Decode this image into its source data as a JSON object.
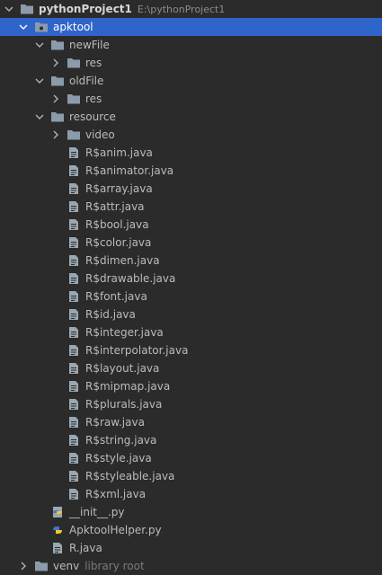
{
  "tree": {
    "root": {
      "label": "pythonProject1",
      "path": "E:\\pythonProject1"
    },
    "apktool": {
      "label": "apktool"
    },
    "newFile": {
      "label": "newFile",
      "res": "res"
    },
    "oldFile": {
      "label": "oldFile",
      "res": "res"
    },
    "resource": {
      "label": "resource",
      "video": "video",
      "files": [
        "R$anim.java",
        "R$animator.java",
        "R$array.java",
        "R$attr.java",
        "R$bool.java",
        "R$color.java",
        "R$dimen.java",
        "R$drawable.java",
        "R$font.java",
        "R$id.java",
        "R$integer.java",
        "R$interpolator.java",
        "R$layout.java",
        "R$mipmap.java",
        "R$plurals.java",
        "R$raw.java",
        "R$string.java",
        "R$style.java",
        "R$styleable.java",
        "R$xml.java"
      ]
    },
    "apktool_files": [
      {
        "label": "__init__.py",
        "icon": "python-package-icon"
      },
      {
        "label": "ApktoolHelper.py",
        "icon": "python-file-icon"
      },
      {
        "label": "R.java",
        "icon": "java-file-icon"
      }
    ],
    "venv": {
      "label": "venv",
      "note": "library root"
    }
  },
  "colors": {
    "background": "#2b2b2b",
    "selection": "#2f65ca",
    "folder": "#8c9bab",
    "text": "#bbbbbb"
  }
}
